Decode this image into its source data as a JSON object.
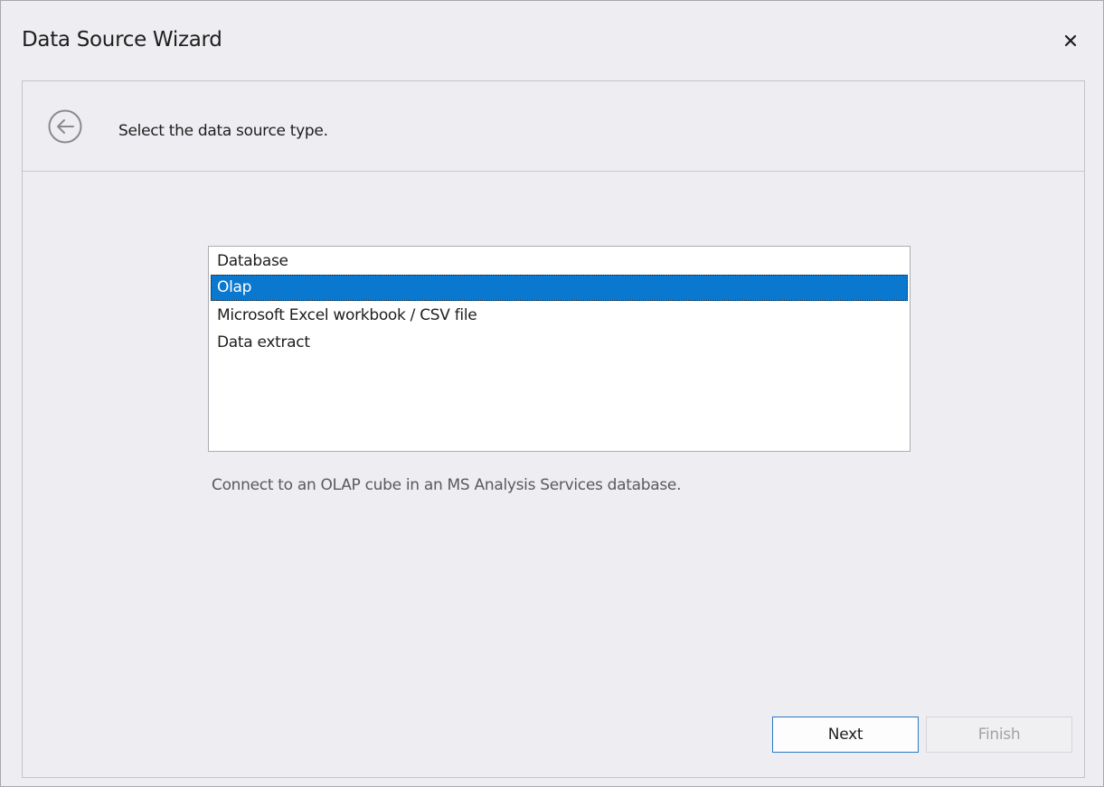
{
  "window": {
    "title": "Data Source Wizard",
    "close_icon": "close-icon"
  },
  "header": {
    "back_icon": "circle-arrow-left-icon",
    "text": "Select the data source type."
  },
  "data_source_list": {
    "items": [
      {
        "label": "Database",
        "selected": false
      },
      {
        "label": "Olap",
        "selected": true
      },
      {
        "label": "Microsoft Excel workbook / CSV file",
        "selected": false
      },
      {
        "label": "Data extract",
        "selected": false
      }
    ],
    "selection_color": "#0b78d0"
  },
  "description": "Connect to an OLAP cube in an MS Analysis Services database.",
  "footer": {
    "next_label": "Next",
    "finish_label": "Finish",
    "finish_enabled": false
  }
}
